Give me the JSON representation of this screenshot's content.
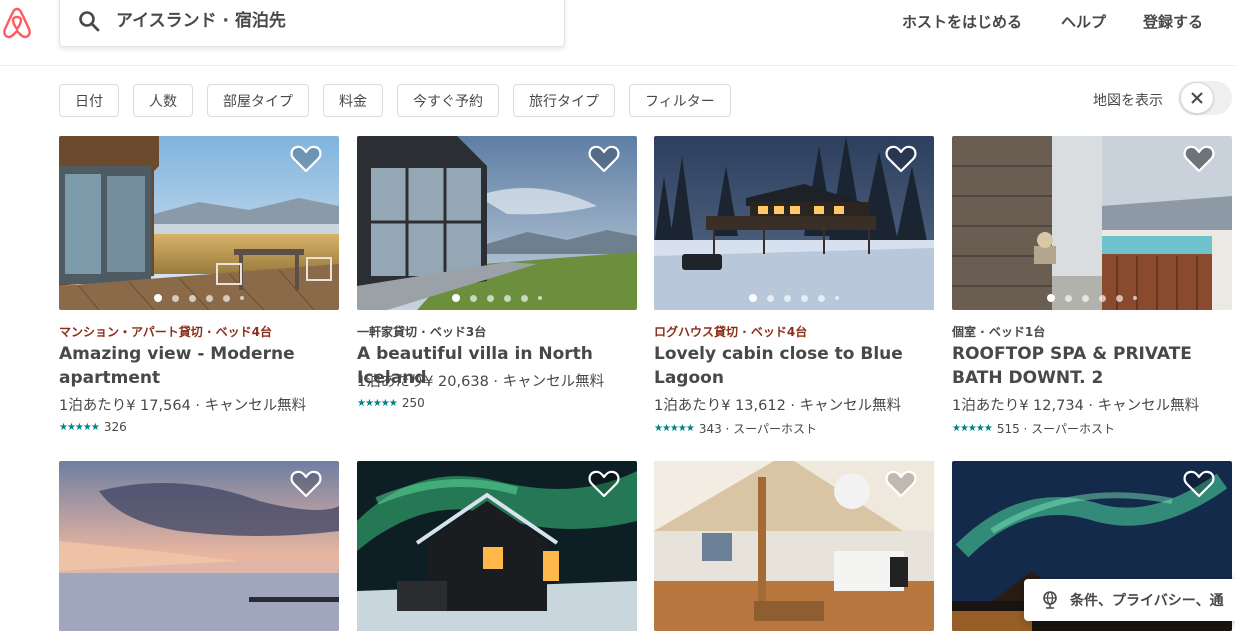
{
  "header": {
    "search_value": "アイスランド · 宿泊先",
    "nav": [
      "ホストをはじめる",
      "ヘルプ",
      "登録する"
    ]
  },
  "filters": [
    "日付",
    "人数",
    "部屋タイプ",
    "料金",
    "今すぐ予約",
    "旅行タイプ",
    "フィルター"
  ],
  "map": {
    "label": "地図を表示",
    "toggle_state": "off"
  },
  "colors": {
    "brand": "#FF5A5F",
    "star": "#008489",
    "type_entire": "#8B2E19",
    "type_other": "#484848"
  },
  "listings": [
    {
      "type": "マンション・アパート貸切 · ベッド4台",
      "title": "Amazing view - Moderne apartment",
      "price": "1泊あたり¥ 17,564 · キャンセル無料",
      "stars": "★★★★★",
      "rating_text": "326",
      "rating_value": 4.5
    },
    {
      "type": "一軒家貸切 · ベッド3台",
      "title": "A beautiful villa in North Iceland",
      "price": "1泊あたり¥ 20,638 · キャンセル無料",
      "stars": "★★★★★",
      "rating_text": "250",
      "rating_value": 5
    },
    {
      "type": "ログハウス貸切 · ベッド4台",
      "title": "Lovely cabin close to Blue Lagoon",
      "price": "1泊あたり¥ 13,612 · キャンセル無料",
      "stars": "★★★★★",
      "rating_text": "343 · スーパーホスト",
      "rating_value": 5
    },
    {
      "type": "個室 · ベッド1台",
      "title": "ROOFTOP SPA & PRIVATE BATH DOWNT. 2",
      "price": "1泊あたり¥ 12,734 · キャンセル無料",
      "stars": "★★★★★",
      "rating_text": "515 · スーパーホスト",
      "rating_value": 5
    }
  ],
  "privacy_banner": "条件、プライバシー、通"
}
